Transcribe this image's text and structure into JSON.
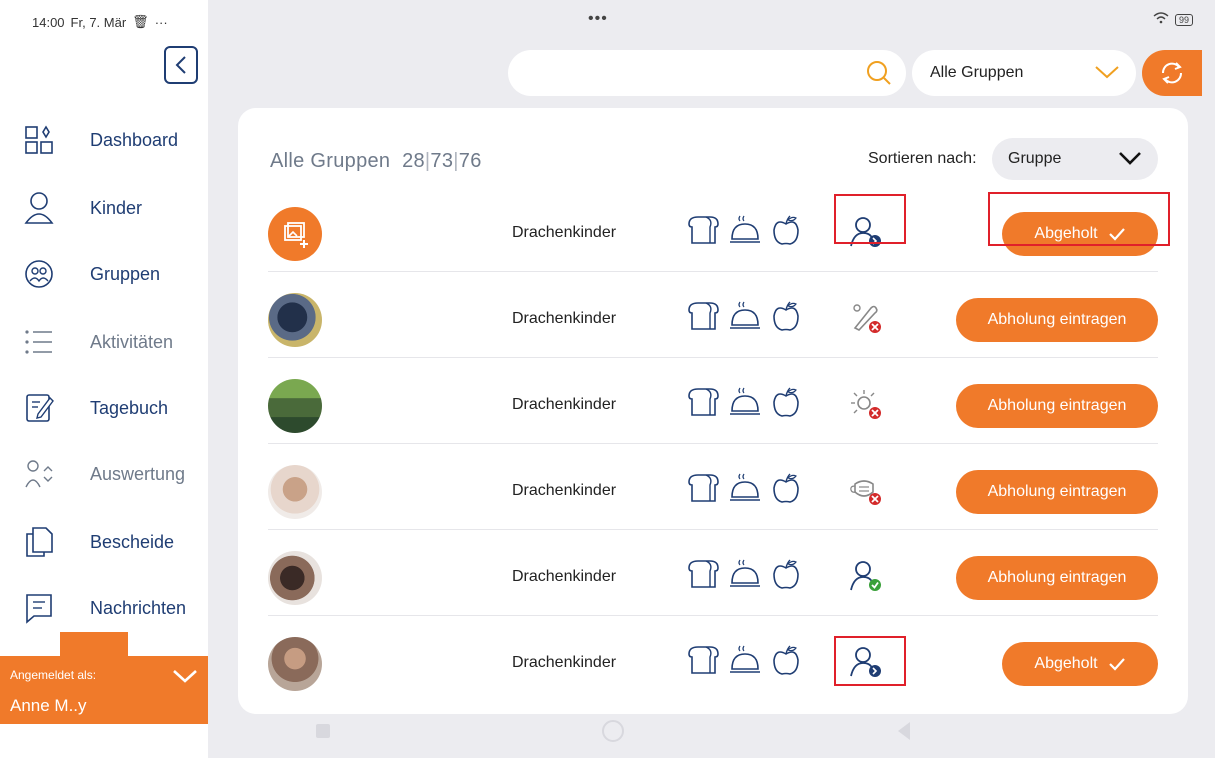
{
  "statusbar": {
    "time": "14:00",
    "date": "Fr, 7. Mär",
    "more": "···",
    "battery": "99"
  },
  "sidebar": {
    "items": [
      {
        "label": "Dashboard",
        "icon": "dashboard-icon",
        "active": true
      },
      {
        "label": "Kinder",
        "icon": "child-icon",
        "active": true
      },
      {
        "label": "Gruppen",
        "icon": "groups-icon",
        "active": true
      },
      {
        "label": "Aktivitäten",
        "icon": "list-icon",
        "active": false
      },
      {
        "label": "Tagebuch",
        "icon": "diary-icon",
        "active": true
      },
      {
        "label": "Auswertung",
        "icon": "evaluation-icon",
        "active": false
      },
      {
        "label": "Bescheide",
        "icon": "documents-icon",
        "active": true
      },
      {
        "label": "Nachrichten",
        "icon": "messages-icon",
        "active": true
      }
    ],
    "login": {
      "label": "Angemeldet als:",
      "name": "Anne M..y"
    }
  },
  "header": {
    "search_placeholder": "",
    "group_filter": "Alle Gruppen",
    "top_dots": "•••"
  },
  "card": {
    "title": "Alle Gruppen",
    "counts": [
      "28",
      "73",
      "76"
    ],
    "sort_label": "Sortieren nach:",
    "sort_value": "Gruppe"
  },
  "rows": [
    {
      "group": "Drachenkinder",
      "status_icon": "person-arrow-icon",
      "action": "Abgeholt",
      "picked": true,
      "highlight": true
    },
    {
      "group": "Drachenkinder",
      "status_icon": "thermometer-cross-icon",
      "action": "Abholung eintragen",
      "picked": false,
      "highlight": false
    },
    {
      "group": "Drachenkinder",
      "status_icon": "sun-cross-icon",
      "action": "Abholung eintragen",
      "picked": false,
      "highlight": false
    },
    {
      "group": "Drachenkinder",
      "status_icon": "mask-cross-icon",
      "action": "Abholung eintragen",
      "picked": false,
      "highlight": false
    },
    {
      "group": "Drachenkinder",
      "status_icon": "person-check-icon",
      "action": "Abholung eintragen",
      "picked": false,
      "highlight": false
    },
    {
      "group": "Drachenkinder",
      "status_icon": "person-arrow-icon",
      "action": "Abgeholt",
      "picked": true,
      "highlight": true
    }
  ],
  "colors": {
    "accent": "#f07a2a",
    "nav": "#1f3d73",
    "highlight": "#e0202a",
    "success": "#3aa03a",
    "error": "#d32a2a"
  }
}
